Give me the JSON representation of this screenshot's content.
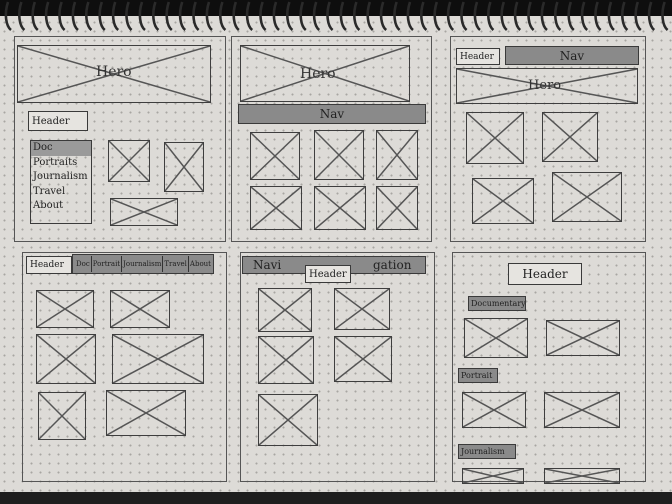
{
  "sketch": {
    "panel_1": {
      "hero": "Hero",
      "header": "Header",
      "menu": [
        "Doc",
        "Portraits",
        "Journalism",
        "Travel",
        "About"
      ],
      "selected": "Doc"
    },
    "panel_2": {
      "hero": "Hero",
      "nav": "Nav"
    },
    "panel_3": {
      "header": "Header",
      "nav": "Nav",
      "hero": "Hero"
    },
    "panel_4": {
      "header": "Header",
      "nav_items": [
        "Doc",
        "Portrait",
        "Journalism",
        "Travel",
        "About"
      ]
    },
    "panel_5": {
      "nav_left": "Navi",
      "header": "Header",
      "nav_right": "gation"
    },
    "panel_6": {
      "header": "Header",
      "sections": [
        "Documentary",
        "Portrait",
        "Journalism"
      ]
    }
  }
}
